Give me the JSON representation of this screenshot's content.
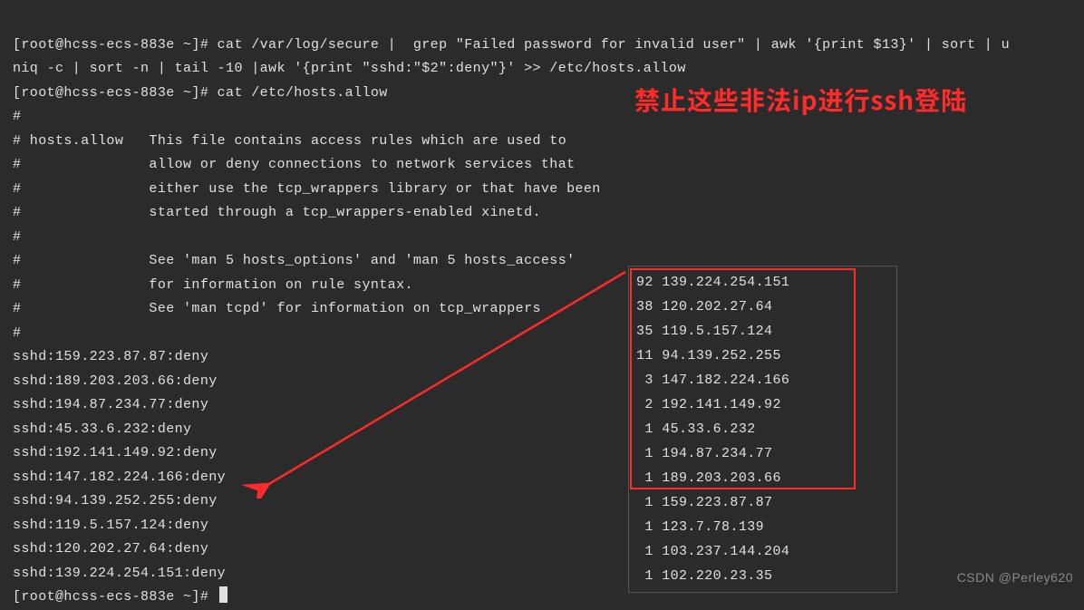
{
  "terminal": {
    "prompt": "[root@hcss-ecs-883e ~]# ",
    "cmd1_line1": "cat /var/log/secure |  grep \"Failed password for invalid user\" | awk '{print $13}' | sort | u",
    "cmd1_line2": "niq -c | sort -n | tail -10 |awk '{print \"sshd:\"$2\":deny\"}' >> /etc/hosts.allow",
    "cmd2": "cat /etc/hosts.allow",
    "file_lines": [
      "#",
      "# hosts.allow   This file contains access rules which are used to",
      "#               allow or deny connections to network services that",
      "#               either use the tcp_wrappers library or that have been",
      "#               started through a tcp_wrappers-enabled xinetd.",
      "#",
      "#               See 'man 5 hosts_options' and 'man 5 hosts_access'",
      "#               for information on rule syntax.",
      "#               See 'man tcpd' for information on tcp_wrappers",
      "#"
    ],
    "deny_rules": [
      "sshd:159.223.87.87:deny",
      "sshd:189.203.203.66:deny",
      "sshd:194.87.234.77:deny",
      "sshd:45.33.6.232:deny",
      "sshd:192.141.149.92:deny",
      "sshd:147.182.224.166:deny",
      "sshd:94.139.252.255:deny",
      "sshd:119.5.157.124:deny",
      "sshd:120.202.27.64:deny",
      "sshd:139.224.254.151:deny"
    ]
  },
  "annotation": "禁止这些非法ip进行ssh登陆",
  "ip_counts": [
    {
      "count": "92",
      "ip": "139.224.254.151",
      "boxed": true
    },
    {
      "count": "38",
      "ip": "120.202.27.64",
      "boxed": true
    },
    {
      "count": "35",
      "ip": "119.5.157.124",
      "boxed": true
    },
    {
      "count": "11",
      "ip": "94.139.252.255",
      "boxed": true
    },
    {
      "count": " 3",
      "ip": "147.182.224.166",
      "boxed": true
    },
    {
      "count": " 2",
      "ip": "192.141.149.92",
      "boxed": true
    },
    {
      "count": " 1",
      "ip": "45.33.6.232",
      "boxed": true
    },
    {
      "count": " 1",
      "ip": "194.87.234.77",
      "boxed": true
    },
    {
      "count": " 1",
      "ip": "189.203.203.66",
      "boxed": true
    },
    {
      "count": " 1",
      "ip": "159.223.87.87",
      "boxed": false
    },
    {
      "count": " 1",
      "ip": "123.7.78.139",
      "boxed": false
    },
    {
      "count": " 1",
      "ip": "103.237.144.204",
      "boxed": false
    },
    {
      "count": " 1",
      "ip": "102.220.23.35",
      "boxed": false
    }
  ],
  "watermark": "CSDN @Perley620"
}
